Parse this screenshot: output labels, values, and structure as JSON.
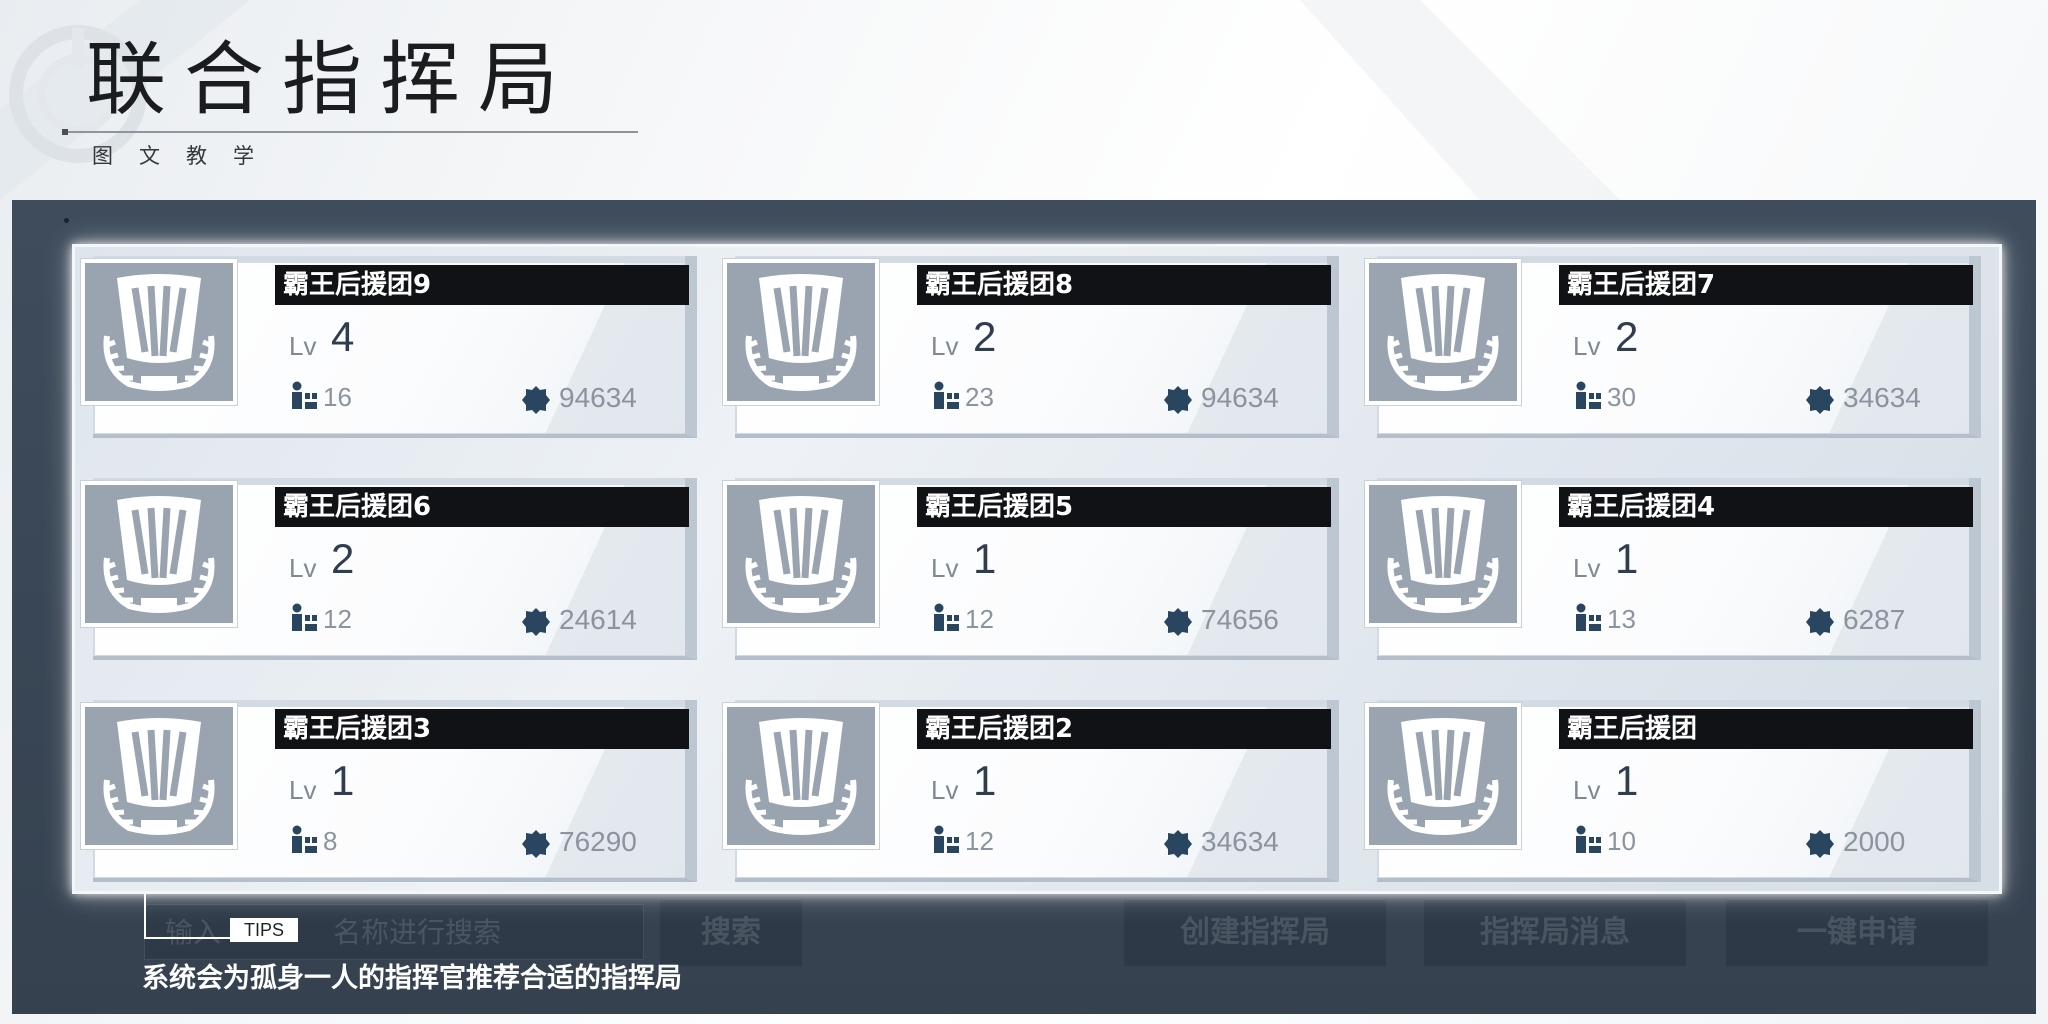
{
  "header": {
    "title": "联合指挥局",
    "subtitle": "图文教学"
  },
  "colors": {
    "frame": "#3e4c5c",
    "name_bar": "#101215",
    "emblem_bg": "#9aa4b1",
    "icon_accent": "#2a4560"
  },
  "icons": {
    "members": "members-icon",
    "power": "gear-icon",
    "emblem": "emblem-icon"
  },
  "cards": [
    {
      "name": "霸王后援团9",
      "lv_label": "Lv",
      "level": "4",
      "members": "16",
      "power": "94634"
    },
    {
      "name": "霸王后援团8",
      "lv_label": "Lv",
      "level": "2",
      "members": "23",
      "power": "94634"
    },
    {
      "name": "霸王后援团7",
      "lv_label": "Lv",
      "level": "2",
      "members": "30",
      "power": "34634"
    },
    {
      "name": "霸王后援团6",
      "lv_label": "Lv",
      "level": "2",
      "members": "12",
      "power": "24614"
    },
    {
      "name": "霸王后援团5",
      "lv_label": "Lv",
      "level": "1",
      "members": "12",
      "power": "74656"
    },
    {
      "name": "霸王后援团4",
      "lv_label": "Lv",
      "level": "1",
      "members": "13",
      "power": "6287"
    },
    {
      "name": "霸王后援团3",
      "lv_label": "Lv",
      "level": "1",
      "members": "8",
      "power": "76290"
    },
    {
      "name": "霸王后援团2",
      "lv_label": "Lv",
      "level": "1",
      "members": "12",
      "power": "34634"
    },
    {
      "name": "霸王后援团",
      "lv_label": "Lv",
      "level": "1",
      "members": "10",
      "power": "2000"
    }
  ],
  "search": {
    "placeholder_prefix": "输入",
    "placeholder_suffix": "名称进行搜索",
    "button": "搜索"
  },
  "actions": {
    "create": "创建指挥局",
    "news": "指挥局消息",
    "apply": "一键申请"
  },
  "tips": {
    "label": "TIPS",
    "text": "系统会为孤身一人的指挥官推荐合适的指挥局"
  }
}
